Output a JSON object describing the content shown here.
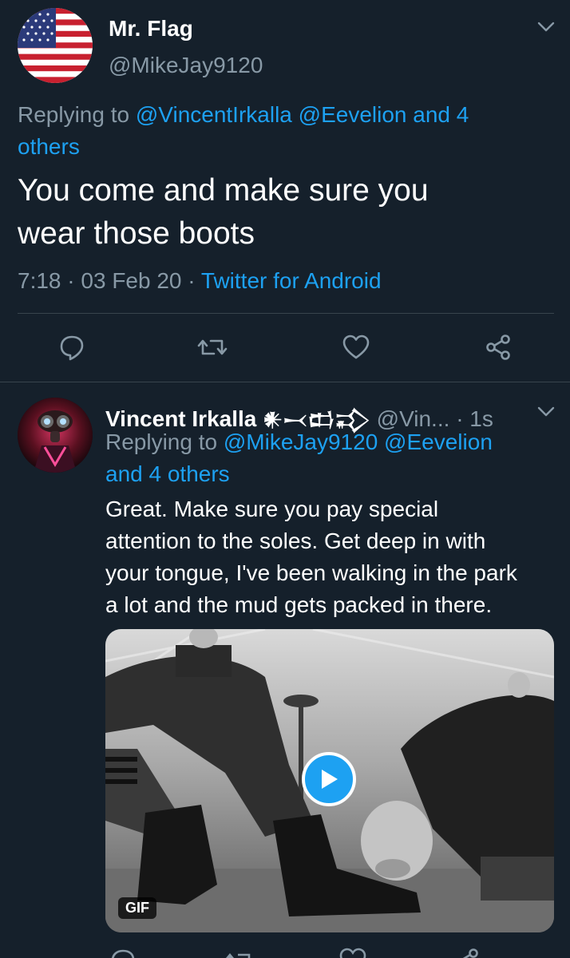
{
  "tweet": {
    "author_name": "Mr. Flag",
    "author_handle": "@MikeJay9120",
    "replying_prefix": "Replying to",
    "replying_mentions_line1": "@VincentIrkalla @Eevelion and 4",
    "replying_mentions_line2": "others",
    "text_line1": "You come and make sure you",
    "text_line2": "wear those boots",
    "time": "7:18",
    "date": "03 Feb 20",
    "source": "Twitter for Android",
    "sep": "·",
    "icons": [
      "comment-icon",
      "retweet-icon",
      "like-icon",
      "share-icon",
      "chevron-down-icon"
    ]
  },
  "reply": {
    "author_name": "Vincent Irkalla",
    "author_glyphs": "𒀭𒁁𒆗𒃾",
    "author_handle": "@Vin...",
    "age": "· 1s",
    "replying_prefix": "Replying to",
    "replying_mentions_line1": "@MikeJay9120 @Eevelion",
    "replying_mentions_line2": "and 4 others",
    "text_lines": [
      "Great. Make sure you pay special",
      "attention to the soles. Get deep in with",
      "your tongue, I've been walking in the park",
      "a lot and the mud gets packed in there."
    ],
    "media_badge": "GIF"
  },
  "colors": {
    "background": "#15202b",
    "accent": "#1da1f2",
    "secondary_text": "#8899a6",
    "divider": "#38444d"
  }
}
